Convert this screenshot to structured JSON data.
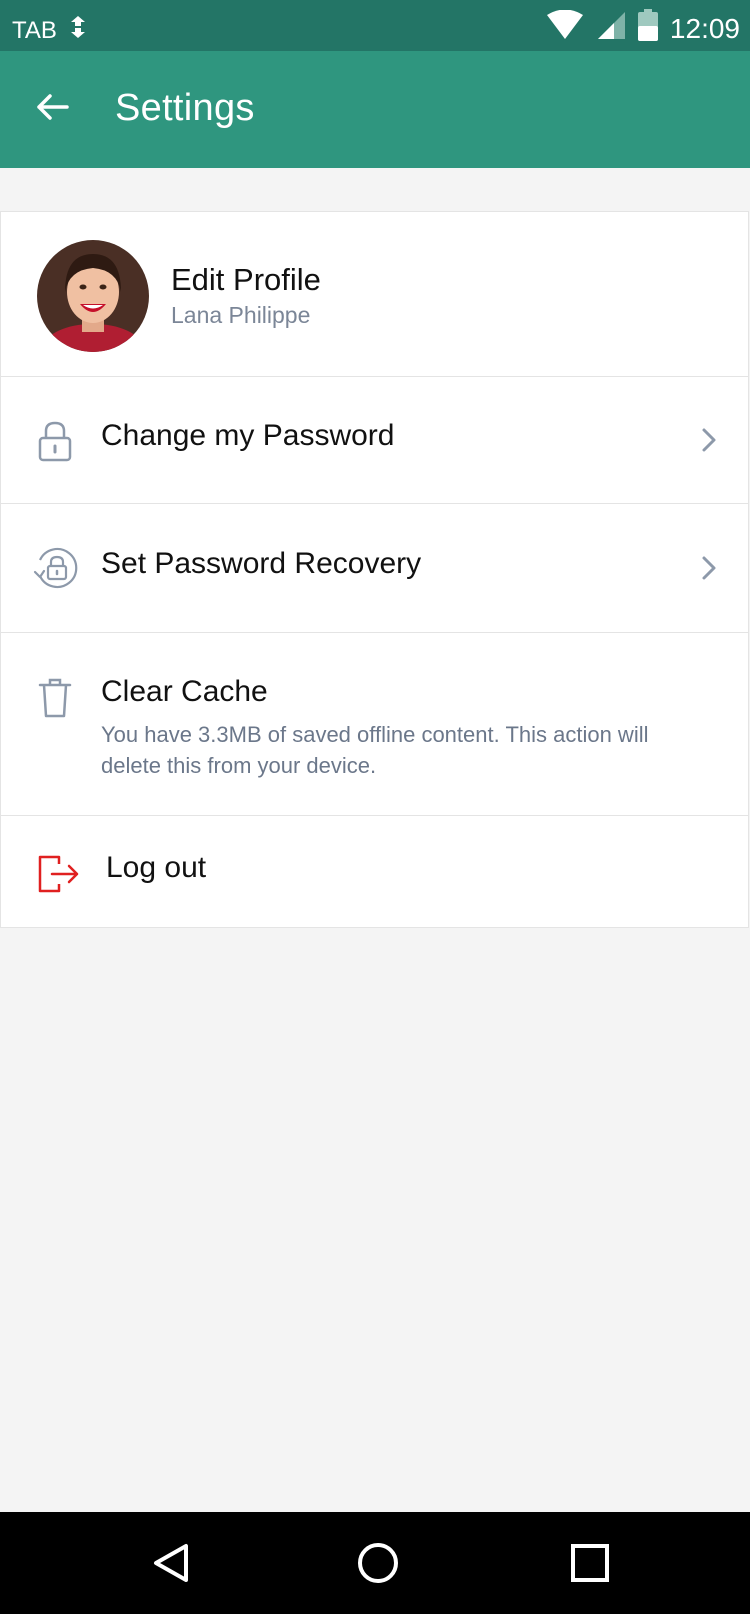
{
  "status_bar": {
    "carrier": "TAB",
    "time": "12:09",
    "icons": [
      "data-sync-icon",
      "wifi-icon",
      "signal-icon",
      "battery-icon"
    ]
  },
  "app_bar": {
    "title": "Settings",
    "background": "#2f967f",
    "status_background": "#237566"
  },
  "profile": {
    "title": "Edit Profile",
    "name": "Lana Philippe"
  },
  "items": [
    {
      "label": "Change my Password",
      "icon": "lock-icon"
    },
    {
      "label": "Set Password Recovery",
      "icon": "lock-recovery-icon"
    },
    {
      "label": "Clear Cache",
      "icon": "trash-icon",
      "description": "You have 3.3MB of saved offline content. This action will delete this from your device."
    },
    {
      "label": "Log out",
      "icon": "logout-icon",
      "color": "#e02020"
    }
  ],
  "nav": [
    "back-nav-icon",
    "home-nav-icon",
    "recents-nav-icon"
  ]
}
